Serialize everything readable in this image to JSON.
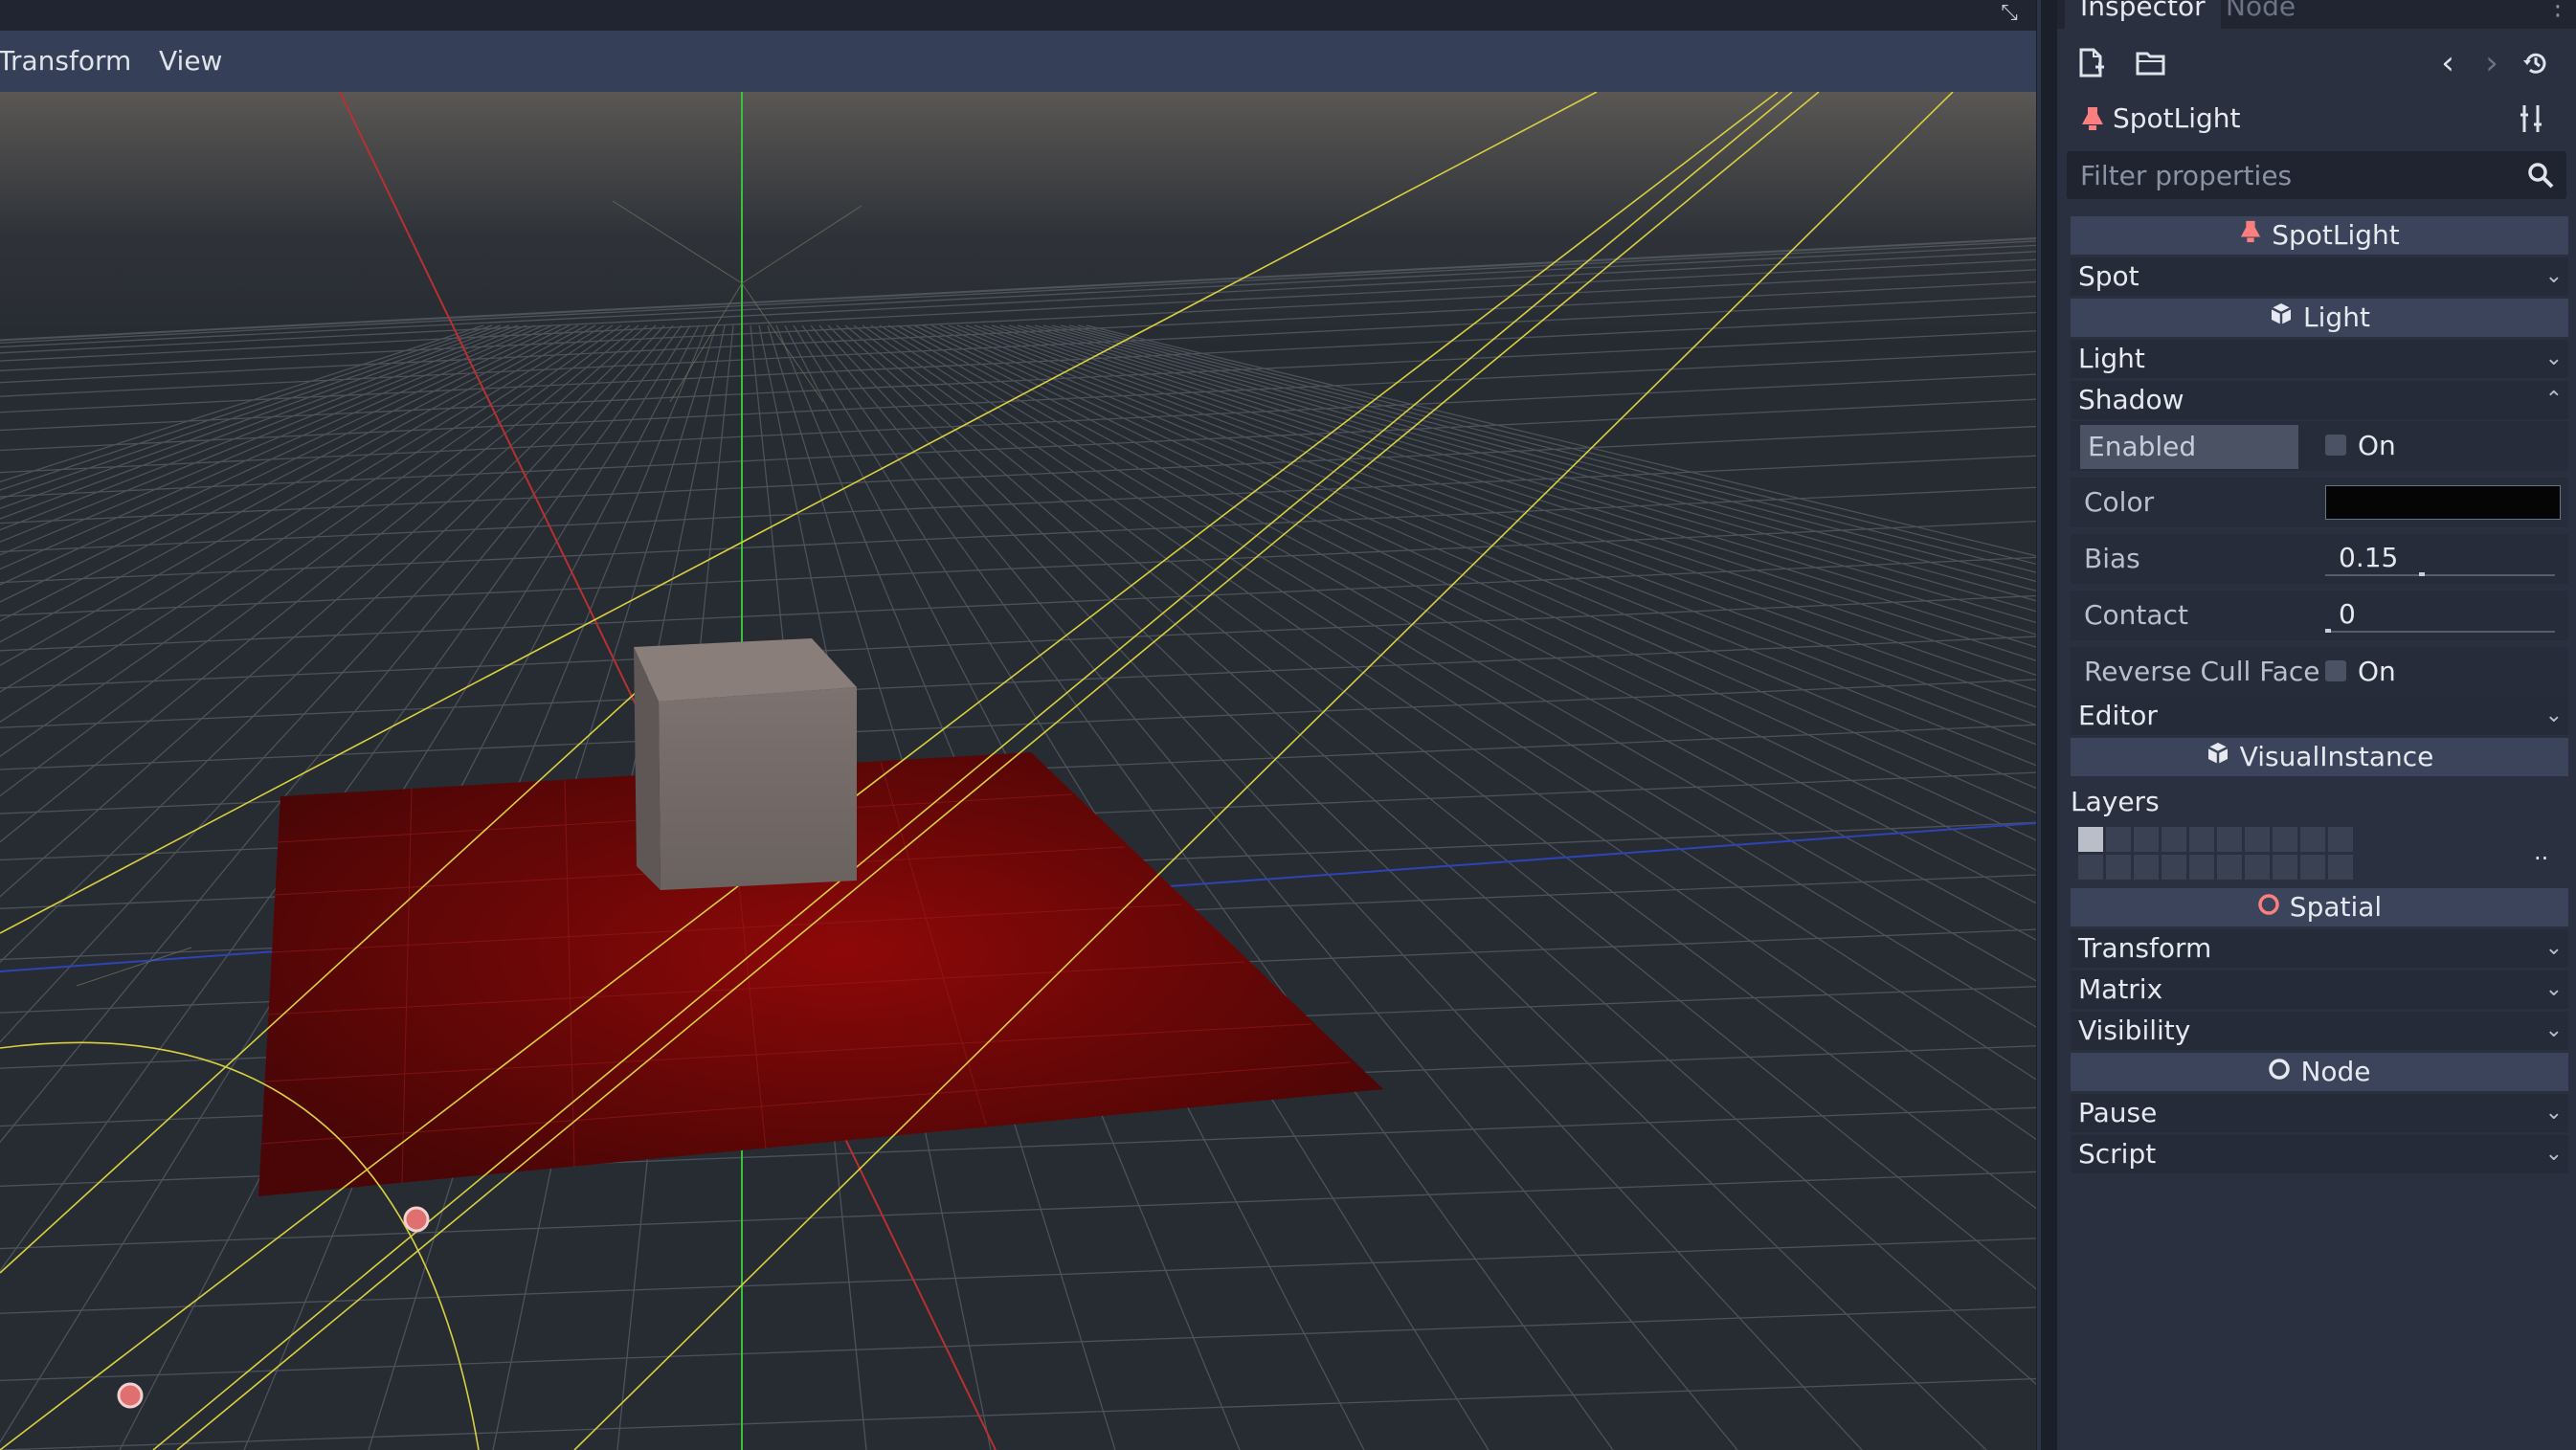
{
  "viewport": {
    "menu": {
      "transform": "Transform",
      "view": "View"
    },
    "icons": {
      "expand": "expand-icon"
    }
  },
  "inspector": {
    "tabs": {
      "inspector": "Inspector",
      "node": "Node"
    },
    "toolbar": {
      "icons": [
        "new-resource-icon",
        "open-resource-icon",
        "back-arrow-icon",
        "forward-arrow-icon",
        "history-icon"
      ]
    },
    "object_name": "SpotLight",
    "filter": {
      "placeholder": "Filter properties"
    },
    "sections": {
      "spotlight": "SpotLight",
      "spot": "Spot",
      "light_class": "Light",
      "light_group": "Light",
      "shadow_group": "Shadow",
      "editor_group": "Editor",
      "visual_instance": "VisualInstance",
      "layers": "Layers",
      "spatial": "Spatial",
      "transform": "Transform",
      "matrix": "Matrix",
      "visibility": "Visibility",
      "node": "Node",
      "pause": "Pause",
      "script": "Script"
    },
    "shadow": {
      "enabled_label": "Enabled",
      "enabled_value": "On",
      "enabled_checked": false,
      "color_label": "Color",
      "color_value": "#050505",
      "bias_label": "Bias",
      "bias_value": "0.15",
      "contact_label": "Contact",
      "contact_value": "0",
      "reverse_cull_label": "Reverse Cull Face",
      "reverse_cull_value": "On",
      "reverse_cull_checked": false
    },
    "layers_more": ".."
  },
  "colors": {
    "panel_bg": "#2a3040",
    "menu_bar": "#353f57",
    "section_header": "#3b445a",
    "spotlight_icon": "#fc7f7f",
    "spatial_icon": "#fc7f7f",
    "x_axis": "#c03030",
    "y_axis": "#3ac03a",
    "z_axis": "#3050d0",
    "gizmo_yellow": "#d8d040",
    "floor_red": "#8a0a0a"
  }
}
